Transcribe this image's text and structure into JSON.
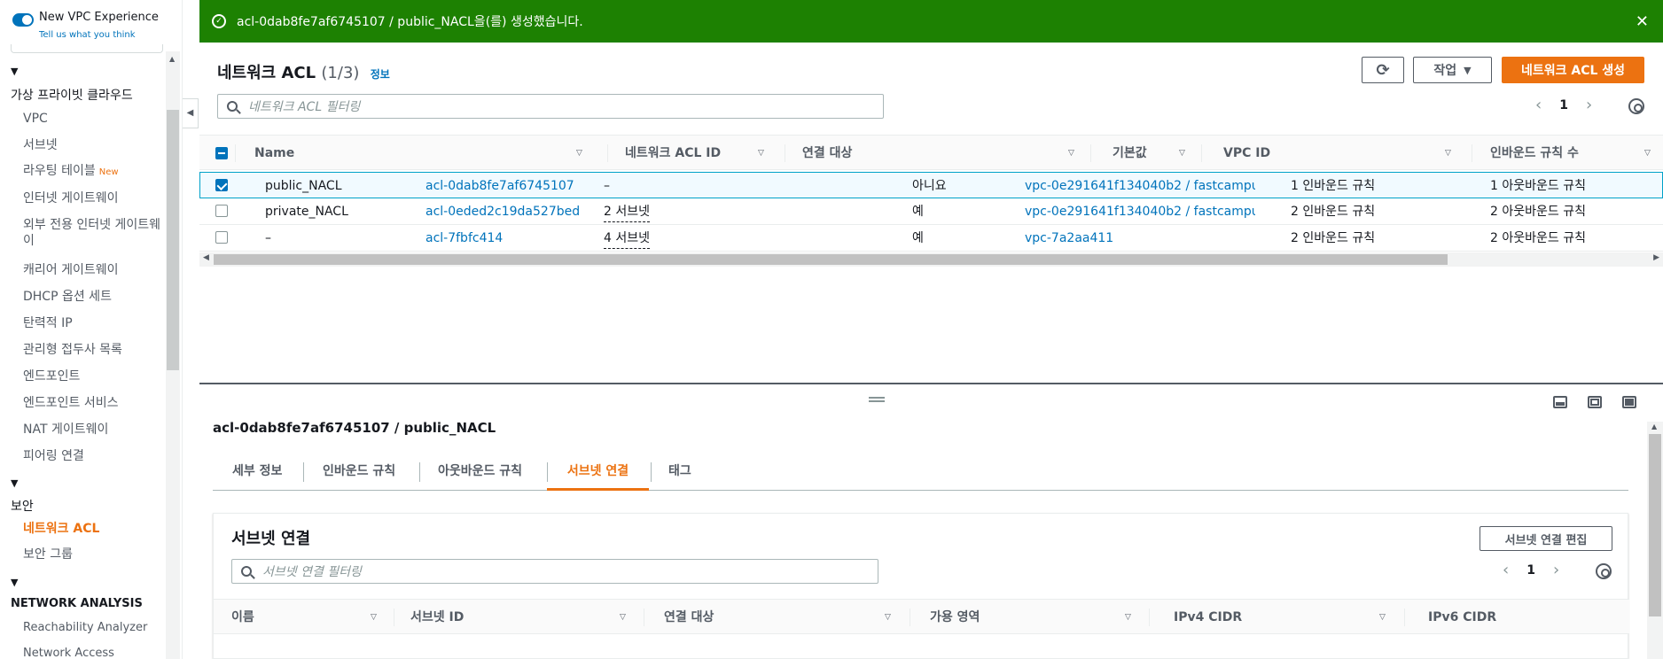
{
  "sidebar": {
    "new_vpc_experience": "New VPC Experience",
    "tell_us": "Tell us what you think",
    "section_vpc": "가상 프라이빗 클라우드",
    "items_vpc": [
      {
        "label": "VPC"
      },
      {
        "label": "서브넷"
      },
      {
        "label": "라우팅 테이블",
        "badge": "New"
      },
      {
        "label": "인터넷 게이트웨이"
      },
      {
        "label": "외부 전용 인터넷 게이트웨이"
      },
      {
        "label": "캐리어 게이트웨이"
      },
      {
        "label": "DHCP 옵션 세트"
      },
      {
        "label": "탄력적 IP"
      },
      {
        "label": "관리형 접두사 목록"
      },
      {
        "label": "엔드포인트"
      },
      {
        "label": "엔드포인트 서비스"
      },
      {
        "label": "NAT 게이트웨이"
      },
      {
        "label": "피어링 연결"
      }
    ],
    "section_security": "보안",
    "items_security": [
      {
        "label": "네트워크 ACL",
        "active": true
      },
      {
        "label": "보안 그룹"
      }
    ],
    "section_network": "NETWORK ANALYSIS",
    "items_network": [
      {
        "label": "Reachability Analyzer"
      },
      {
        "label": "Network Access Analyzer"
      }
    ]
  },
  "flash": {
    "message": "acl-0dab8fe7af6745107 / public_NACL을(를) 생성했습니다.",
    "color": "#1d8102"
  },
  "main": {
    "title": "네트워크 ACL",
    "count": "(1/3)",
    "info": "정보",
    "actions_label": "작업",
    "create_label": "네트워크 ACL 생성",
    "search_placeholder": "네트워크 ACL 필터링",
    "page": "1",
    "columns": [
      "Name",
      "네트워크 ACL ID",
      "연결 대상",
      "기본값",
      "VPC ID",
      "인바운드 규칙 수",
      "아웃바운드 규칙 수"
    ],
    "rows": [
      {
        "selected": true,
        "name": "public_NACL",
        "acl_id": "acl-0dab8fe7af6745107",
        "assoc": "–",
        "default": "아니요",
        "vpc_id": "vpc-0e291641f134040b2 / fastcampu...",
        "inbound": "1 인바운드 규칙",
        "outbound": "1 아웃바운드 규칙"
      },
      {
        "selected": false,
        "name": "private_NACL",
        "acl_id": "acl-0eded2c19da527bed",
        "assoc": "2 서브넷",
        "default": "예",
        "vpc_id": "vpc-0e291641f134040b2 / fastcampu...",
        "inbound": "2 인바운드 규칙",
        "outbound": "2 아웃바운드 규칙"
      },
      {
        "selected": false,
        "name": "–",
        "acl_id": "acl-7fbfc414",
        "assoc": "4 서브넷",
        "default": "예",
        "vpc_id": "vpc-7a2aa411",
        "inbound": "2 인바운드 규칙",
        "outbound": "2 아웃바운드 규칙"
      }
    ]
  },
  "detail": {
    "title": "acl-0dab8fe7af6745107 / public_NACL",
    "tabs": [
      "세부 정보",
      "인바운드 규칙",
      "아웃바운드 규칙",
      "서브넷 연결",
      "태그"
    ],
    "active_tab": "서브넷 연결",
    "panel_title": "서브넷 연결",
    "edit_label": "서브넷 연결 편집",
    "search_placeholder": "서브넷 연결 필터링",
    "page": "1",
    "columns": [
      "이름",
      "서브넷 ID",
      "연결 대상",
      "가용 영역",
      "IPv4 CIDR",
      "IPv6 CIDR"
    ]
  },
  "colors": {
    "accent": "#ec7211",
    "link": "#0073bb"
  }
}
